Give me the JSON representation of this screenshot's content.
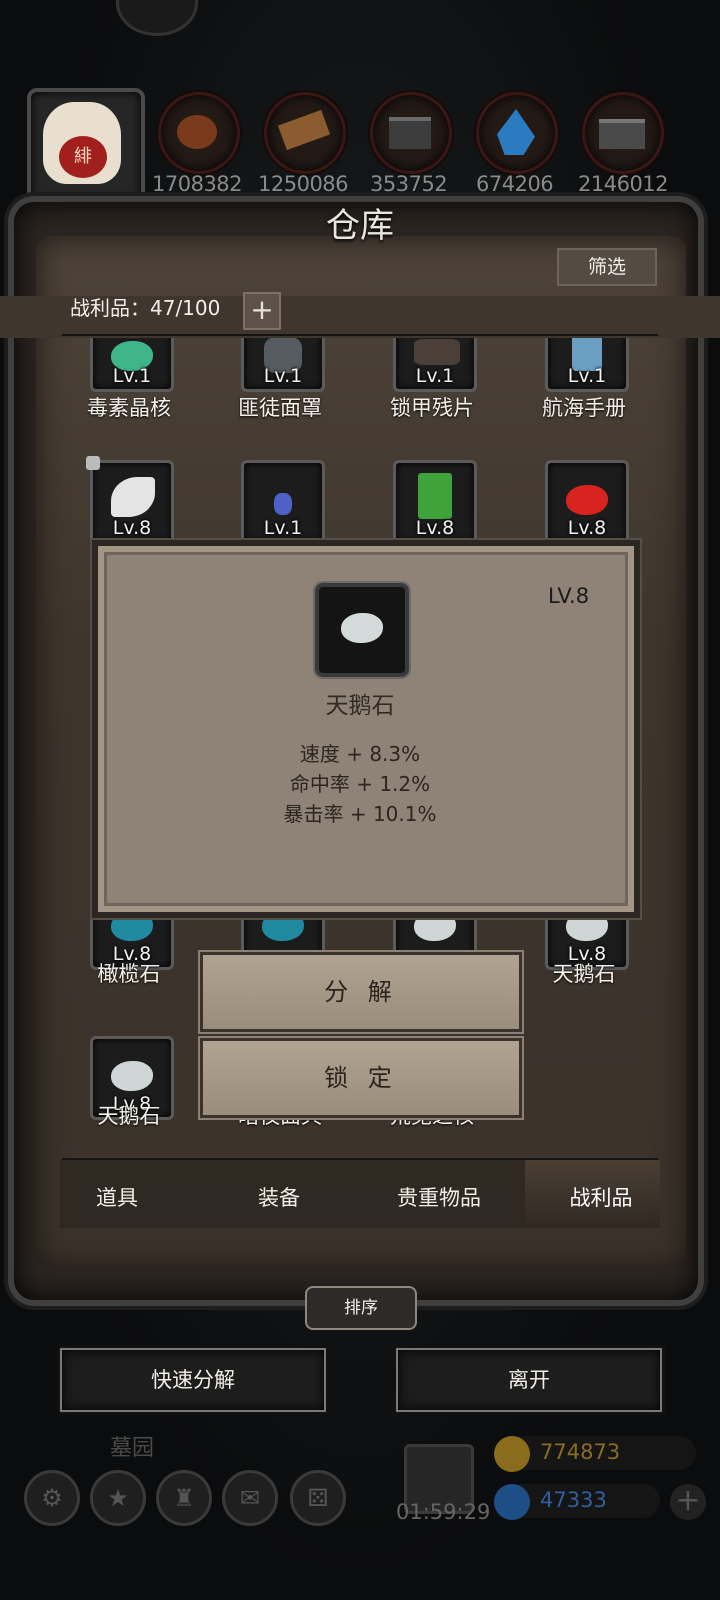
{
  "resources": [
    {
      "icon": "meat-icon",
      "value": "1708382"
    },
    {
      "icon": "wood-icon",
      "value": "1250086"
    },
    {
      "icon": "iron-icon",
      "value": "353752"
    },
    {
      "icon": "crystal-icon",
      "value": "674206"
    },
    {
      "icon": "stone-icon",
      "value": "2146012"
    }
  ],
  "avatar_mark": "緋",
  "panel": {
    "title": "仓库",
    "filter_label": "筛选",
    "count_label": "战利品：47/100",
    "add_label": "+"
  },
  "items_row1": [
    {
      "lv": "Lv.1",
      "name": "毒素晶核"
    },
    {
      "lv": "Lv.1",
      "name": "匪徒面罩"
    },
    {
      "lv": "Lv.1",
      "name": "锁甲残片"
    },
    {
      "lv": "Lv.1",
      "name": "航海手册"
    }
  ],
  "items_row2": [
    {
      "lv": "Lv.8"
    },
    {
      "lv": "Lv.1"
    },
    {
      "lv": "Lv.8"
    },
    {
      "lv": "Lv.8"
    }
  ],
  "items_row3": [
    {
      "lv": "Lv.8",
      "name": "橄榄石"
    },
    {
      "lv": "",
      "name": ""
    },
    {
      "lv": "",
      "name": ""
    },
    {
      "lv": "Lv.8",
      "name": "天鹅石"
    }
  ],
  "items_row4": [
    {
      "lv": "Lv.8",
      "name": "天鹅石"
    },
    {
      "name": "暗夜面具"
    },
    {
      "name": "荒芜之核"
    }
  ],
  "popup": {
    "level": "LV.8",
    "name": "天鹅石",
    "stats": [
      "速度 + 8.3%",
      "命中率 + 1.2%",
      "暴击率 + 10.1%"
    ]
  },
  "actions": {
    "decompose": "分 解",
    "lock": "锁 定"
  },
  "tabs": [
    "道具",
    "装备",
    "贵重物品",
    "战利品"
  ],
  "active_tab": "战利品",
  "sort_label": "排序",
  "quick_decompose": "快速分解",
  "leave": "离开",
  "bottom": {
    "location": "墓园",
    "timer": "01:59:29",
    "gold": "774873",
    "gems": "47333"
  },
  "colors": {
    "gold": "#a0822c",
    "gem": "#2c6db3",
    "accent": "#e8e2d6"
  }
}
